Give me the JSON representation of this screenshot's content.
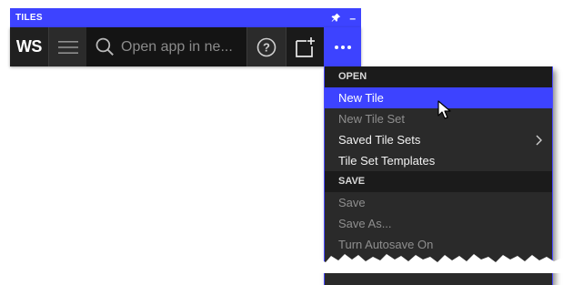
{
  "window": {
    "title": "TILES",
    "pin_icon": "pin-icon",
    "minimize_label": "–"
  },
  "toolbar": {
    "logo": "WS",
    "menu_icon": "hamburger-menu-icon",
    "search": {
      "placeholder": "Open app in ne...",
      "value": ""
    },
    "help_icon": "help-circle-icon",
    "new_tile_icon": "new-tile-icon",
    "more_icon": "more-dots-icon"
  },
  "menu": {
    "open_section": "OPEN",
    "items_open": [
      {
        "label": "New Tile",
        "state": "selected"
      },
      {
        "label": "New Tile Set",
        "state": "disabled"
      },
      {
        "label": "Saved Tile Sets",
        "state": "enabled",
        "submenu": true
      },
      {
        "label": "Tile Set Templates",
        "state": "enabled"
      }
    ],
    "save_section": "SAVE",
    "items_save": [
      {
        "label": "Save",
        "state": "disabled"
      },
      {
        "label": "Save As...",
        "state": "disabled"
      },
      {
        "label": "Turn Autosave On",
        "state": "disabled"
      }
    ]
  },
  "colors": {
    "accent": "#3d43ff",
    "toolbar_bg": "#202020",
    "menu_bg": "#2a2a2a",
    "section_bg": "#1b1b1b",
    "disabled_text": "#8e8e8e"
  }
}
